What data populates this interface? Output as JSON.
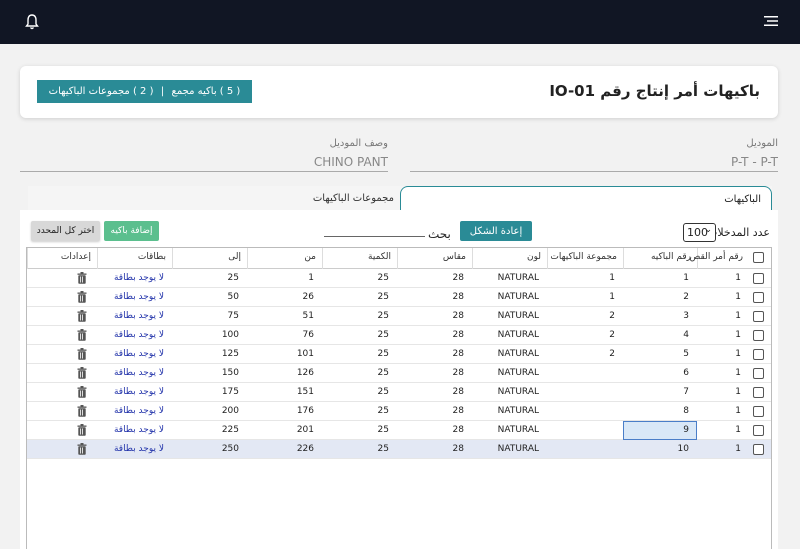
{
  "page_title": "باكيهات أمر إنتاج رقم IO-01",
  "bundle_button": {
    "left_label": "( 2 ) مجموعات الباكيهات",
    "separator": "|",
    "right_label": "( 5 ) باكيه مجمع"
  },
  "model": {
    "label": "الموديل",
    "value": "P-T - P-T"
  },
  "model_desc": {
    "label": "وصف الموديل",
    "value": "CHINO PANT"
  },
  "tabs": {
    "active": "الباكيهات",
    "inactive": "مجموعات الباكيهات"
  },
  "toolbar": {
    "entries_label": "عدد المدخلات",
    "entries_value": "100",
    "reset_label": "إعادة الشكل",
    "search_label": "بحث",
    "add_label": "إضافة باكيه",
    "select_all_label": "اختر كل المحدد"
  },
  "table": {
    "columns": [
      "رقم أمر القص",
      "رقم الباكيه",
      "مجموعة الباكيهات",
      "لون",
      "مقاس",
      "الكمية",
      "من",
      "إلى",
      "بطاقات",
      "إعدادات"
    ],
    "rows": [
      {
        "cut": "1",
        "bundle": "1",
        "group": "1",
        "color": "NATURAL",
        "size": "28",
        "qty": "25",
        "from": "1",
        "to": "25",
        "cards": "لا يوجد بطاقة"
      },
      {
        "cut": "1",
        "bundle": "2",
        "group": "1",
        "color": "NATURAL",
        "size": "28",
        "qty": "25",
        "from": "26",
        "to": "50",
        "cards": "لا يوجد بطاقة"
      },
      {
        "cut": "1",
        "bundle": "3",
        "group": "2",
        "color": "NATURAL",
        "size": "28",
        "qty": "25",
        "from": "51",
        "to": "75",
        "cards": "لا يوجد بطاقة"
      },
      {
        "cut": "1",
        "bundle": "4",
        "group": "2",
        "color": "NATURAL",
        "size": "28",
        "qty": "25",
        "from": "76",
        "to": "100",
        "cards": "لا يوجد بطاقة"
      },
      {
        "cut": "1",
        "bundle": "5",
        "group": "2",
        "color": "NATURAL",
        "size": "28",
        "qty": "25",
        "from": "101",
        "to": "125",
        "cards": "لا يوجد بطاقة"
      },
      {
        "cut": "1",
        "bundle": "6",
        "group": "",
        "color": "NATURAL",
        "size": "28",
        "qty": "25",
        "from": "126",
        "to": "150",
        "cards": "لا يوجد بطاقة"
      },
      {
        "cut": "1",
        "bundle": "7",
        "group": "",
        "color": "NATURAL",
        "size": "28",
        "qty": "25",
        "from": "151",
        "to": "175",
        "cards": "لا يوجد بطاقة"
      },
      {
        "cut": "1",
        "bundle": "8",
        "group": "",
        "color": "NATURAL",
        "size": "28",
        "qty": "25",
        "from": "176",
        "to": "200",
        "cards": "لا يوجد بطاقة"
      },
      {
        "cut": "1",
        "bundle": "9",
        "group": "",
        "color": "NATURAL",
        "size": "28",
        "qty": "25",
        "from": "201",
        "to": "225",
        "cards": "لا يوجد بطاقة"
      },
      {
        "cut": "1",
        "bundle": "10",
        "group": "",
        "color": "NATURAL",
        "size": "28",
        "qty": "25",
        "from": "226",
        "to": "250",
        "cards": "لا يوجد بطاقة"
      }
    ]
  },
  "colors": {
    "accent": "#2a8b96",
    "add_button": "#5bbf8e",
    "topbar": "#111624",
    "link": "#2233aa"
  },
  "icons": {
    "top_left": "bell-icon",
    "top_right": "hamburger-menu-icon",
    "row_action": "trash-icon"
  }
}
